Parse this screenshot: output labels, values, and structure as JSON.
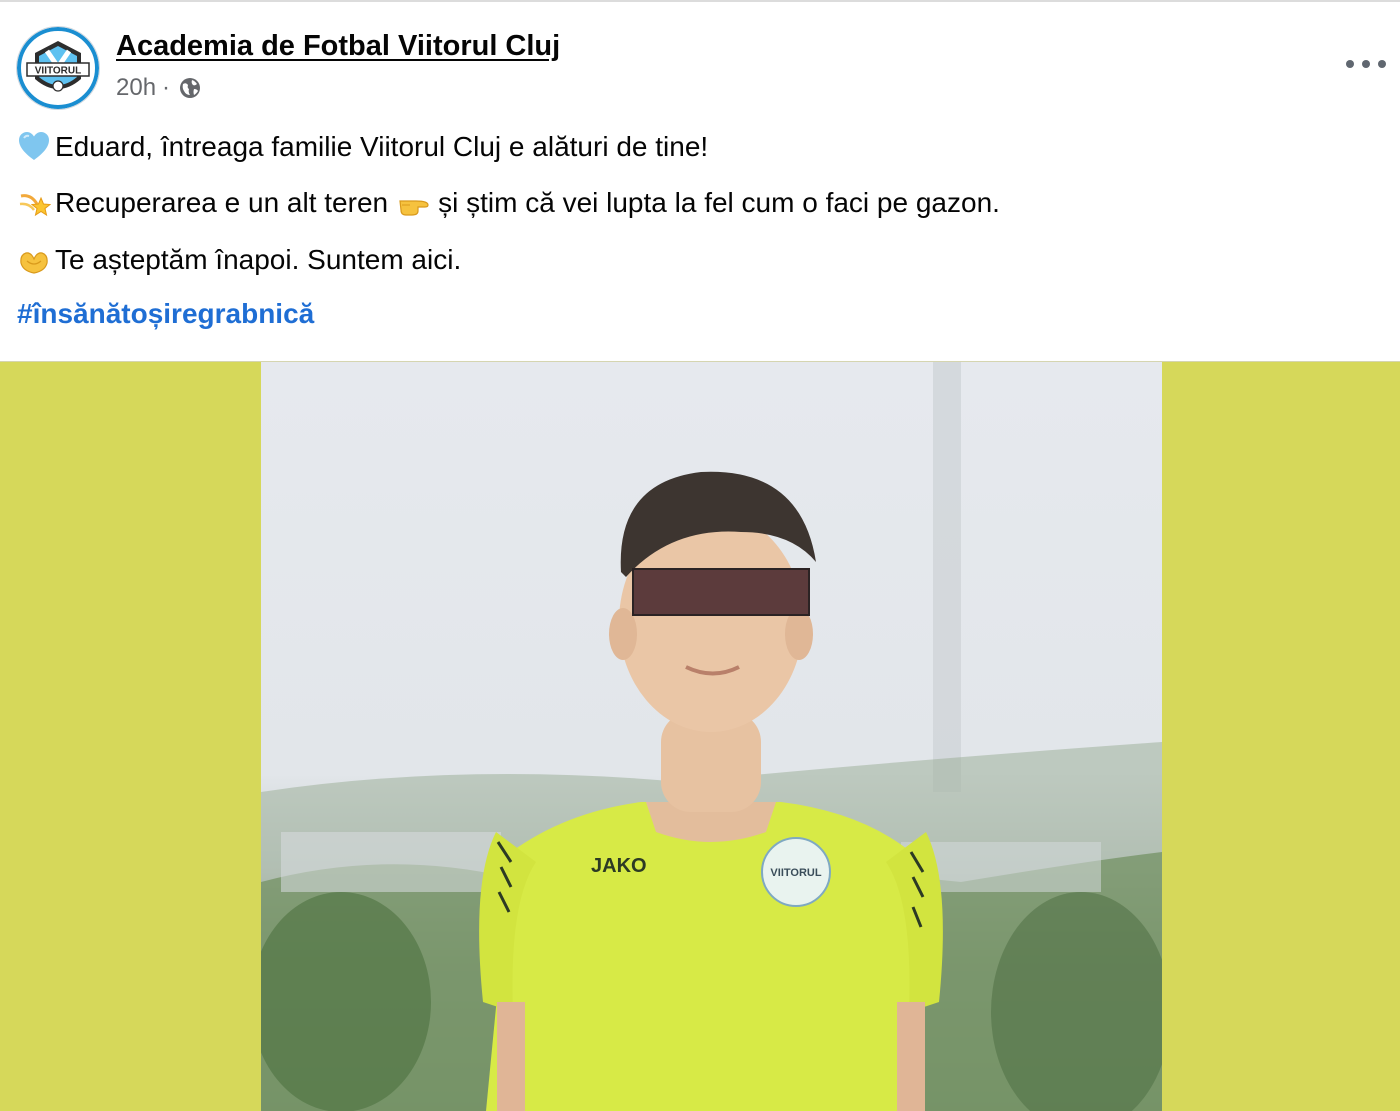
{
  "post": {
    "author": "Academia de Fotbal Viitorul Cluj",
    "time": "20h",
    "separator": "·",
    "avatar_text": "VIITORUL",
    "lines": [
      {
        "emoji": "light-blue-heart",
        "text": "Eduard, întreaga familie Viitorul Cluj e alături de tine!"
      },
      {
        "emoji": "dizzy",
        "text_before": "Recuperarea e un alt teren",
        "inline_emoji": "pointing-right",
        "text_after": "și știm că vei lupta la fel cum o faci pe gazon."
      },
      {
        "emoji": "heart-hands",
        "text": "Te așteptăm înapoi. Suntem aici."
      }
    ],
    "hashtag": "#însănătoșiregrabnică"
  },
  "photo": {
    "shirt_brand": "JAKO",
    "badge_text": "VIITORUL",
    "background_color": "#d6d85a",
    "shirt_color": "#d7ea46"
  },
  "colors": {
    "hashtag": "#1f6ed4",
    "meta": "#65676b"
  }
}
